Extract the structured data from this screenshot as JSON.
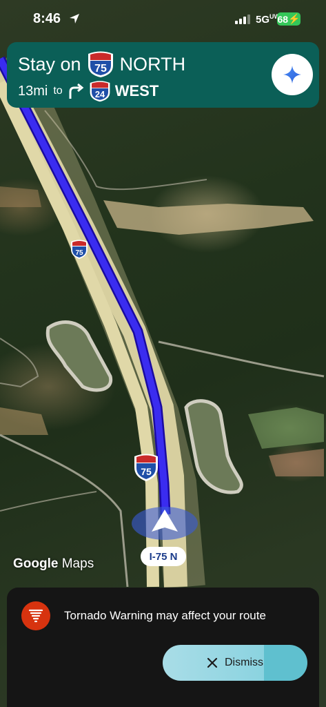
{
  "status_bar": {
    "time": "8:46",
    "network": "5G",
    "network_suffix": "UW",
    "battery": "68"
  },
  "navigation": {
    "instruction_prefix": "Stay on",
    "current_route_number": "75",
    "current_route_direction": "NORTH",
    "next_distance": "13mi",
    "next_connector": "to",
    "next_route_number": "24",
    "next_route_direction": "WEST",
    "assistant_icon": "sparkle-icon"
  },
  "map": {
    "attribution_brand": "Google",
    "attribution_product": "Maps",
    "current_road_label": "I-75 N",
    "route_shield_labels": [
      "75",
      "75"
    ],
    "route_color": "#3a2cf0",
    "road_color": "#d7cf9f"
  },
  "alert": {
    "icon": "tornado-icon",
    "message": "Tornado Warning may affect your route",
    "dismiss_label": "Dismiss",
    "dismiss_icon": "close-icon",
    "accent_color": "#d7330f"
  }
}
